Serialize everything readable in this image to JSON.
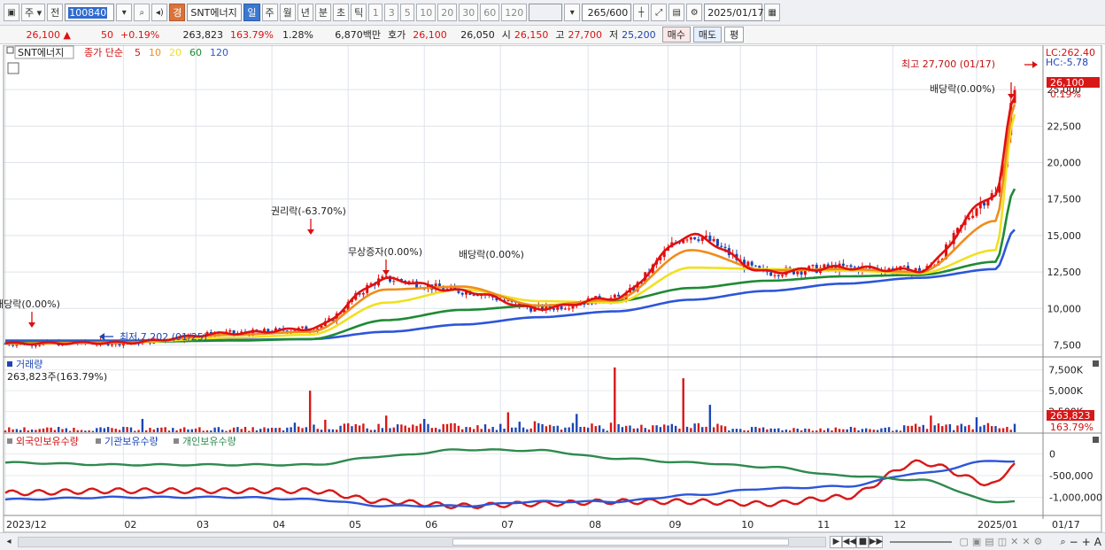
{
  "toolbar": {
    "period_select": "주",
    "prev_label": "전",
    "code": "100840",
    "name": "SNT에너지",
    "badge": "경",
    "periods": [
      "일",
      "주",
      "월",
      "년",
      "분",
      "초",
      "틱"
    ],
    "selected_period": "일",
    "nums": [
      "1",
      "3",
      "5",
      "10",
      "20",
      "30",
      "60",
      "120"
    ],
    "count": "265",
    "count_total": "/600",
    "date": "2025/01/17"
  },
  "info": {
    "price": "26,100",
    "price_arrow": "▲",
    "change": "50",
    "change_pct": "+0.19%",
    "volume": "263,823",
    "volume_pct": "163.79%",
    "turnover": "1.28%",
    "amount": "6,870백만",
    "quote_label": "호가",
    "ask": "26,100",
    "bid": "26,050",
    "open_label": "시",
    "open": "26,150",
    "high_label": "고",
    "high": "27,700",
    "low_label": "저",
    "low": "25,200",
    "buy_btn": "매수",
    "sell_btn": "매도",
    "eval_btn": "평"
  },
  "legend": {
    "stock": "SNT에너지",
    "ma_prefix": "종가 단순",
    "ma": [
      {
        "label": "5",
        "color": "#e01010"
      },
      {
        "label": "10",
        "color": "#f08c1c"
      },
      {
        "label": "20",
        "color": "#f0e020"
      },
      {
        "label": "60",
        "color": "#1e8a34"
      },
      {
        "label": "120",
        "color": "#2c56d8"
      }
    ]
  },
  "price_panel": {
    "yticks": [
      "25,000",
      "22,500",
      "20,000",
      "17,500",
      "15,000",
      "12,500",
      "10,000",
      "7,500"
    ],
    "lc": "LC:262.40",
    "hc": "HC:-5.78",
    "last_price": "26,100",
    "last_pct": "0.19%",
    "annotations": {
      "high": "최고 27,700 (01/17)",
      "low": "최저 7,202 (01/25)",
      "rights": "권리락(-63.70%)",
      "bonus": "무상증자(0.00%)",
      "div1": "배당락(0.00%)",
      "div2": "배당락(0.00%)",
      "div3": "배당락(0.00%)"
    }
  },
  "volume_panel": {
    "title": "거래량",
    "value": "263,823주(163.79%)",
    "yticks": [
      "7,500K",
      "5,000K",
      "2,500K"
    ],
    "last": "263,823",
    "last_pct": "163.79%"
  },
  "holdings_panel": {
    "legend": [
      "외국인보유수량",
      "기관보유수량",
      "개인보유수량"
    ],
    "yticks": [
      "0",
      "-500,000",
      "-1,000,000"
    ]
  },
  "xaxis": [
    "2023/12",
    "02",
    "03",
    "04",
    "05",
    "06",
    "07",
    "08",
    "09",
    "10",
    "11",
    "12",
    "2025/01",
    "01/17"
  ],
  "chart_data": {
    "type": "line",
    "title": "SNT에너지",
    "price_ylim": [
      6800,
      27800
    ],
    "price_series": [
      {
        "name": "5",
        "color": "#e01010",
        "x": [
          0,
          30,
          60,
          80,
          100,
          120,
          140,
          160,
          180,
          200,
          220,
          240,
          260,
          265
        ],
        "values": [
          7600,
          7650,
          8300,
          8600,
          12000,
          11200,
          10000,
          10700,
          15000,
          12500,
          12800,
          12600,
          17800,
          24500
        ]
      },
      {
        "name": "10",
        "color": "#f08c1c",
        "values": [
          7600,
          7650,
          8200,
          8400,
          11300,
          11500,
          10200,
          10600,
          14000,
          12600,
          12700,
          12500,
          16000,
          24000
        ]
      },
      {
        "name": "20",
        "color": "#f0e020",
        "values": [
          7600,
          7650,
          8000,
          8200,
          10400,
          11300,
          10500,
          10400,
          12800,
          12700,
          12600,
          12400,
          14000,
          23300
        ]
      },
      {
        "name": "60",
        "color": "#1e8a34",
        "values": [
          7700,
          7700,
          7800,
          7900,
          9200,
          9900,
          10200,
          10500,
          11400,
          11900,
          12200,
          12300,
          13200,
          18200
        ]
      },
      {
        "name": "120",
        "color": "#2c56d8",
        "values": [
          7800,
          7800,
          7850,
          7900,
          8400,
          8900,
          9400,
          9800,
          10600,
          11200,
          11700,
          12100,
          12700,
          15400
        ]
      }
    ],
    "volume_ylim": [
      0,
      8000
    ],
    "volume_unit": "K",
    "holdings_ylim": [
      -1400000,
      400000
    ],
    "holdings_series": [
      {
        "name": "외국인보유수량",
        "color": "#d81818",
        "values": [
          -900000,
          -850000,
          -850000,
          -850000,
          -1100000,
          -1200000,
          -1150000,
          -1100000,
          -1100000,
          -1150000,
          -1000000,
          -200000,
          -700000,
          -200000
        ]
      },
      {
        "name": "기관보유수량",
        "color": "#2c56d8",
        "values": [
          -1050000,
          -1000000,
          -1000000,
          -1050000,
          -1200000,
          -1200000,
          -1100000,
          -1100000,
          -950000,
          -800000,
          -750000,
          -450000,
          -150000,
          -180000
        ]
      },
      {
        "name": "개인보유수량",
        "color": "#2e8a4e",
        "values": [
          -200000,
          -250000,
          -250000,
          -250000,
          -50000,
          100000,
          80000,
          -100000,
          -200000,
          -300000,
          -500000,
          -600000,
          -1100000,
          -1100000
        ]
      }
    ]
  },
  "scroll": {
    "buttons": [
      "▶",
      "◀◀",
      "■",
      "▶▶"
    ],
    "zoom": [
      "−",
      "+",
      "A"
    ]
  }
}
